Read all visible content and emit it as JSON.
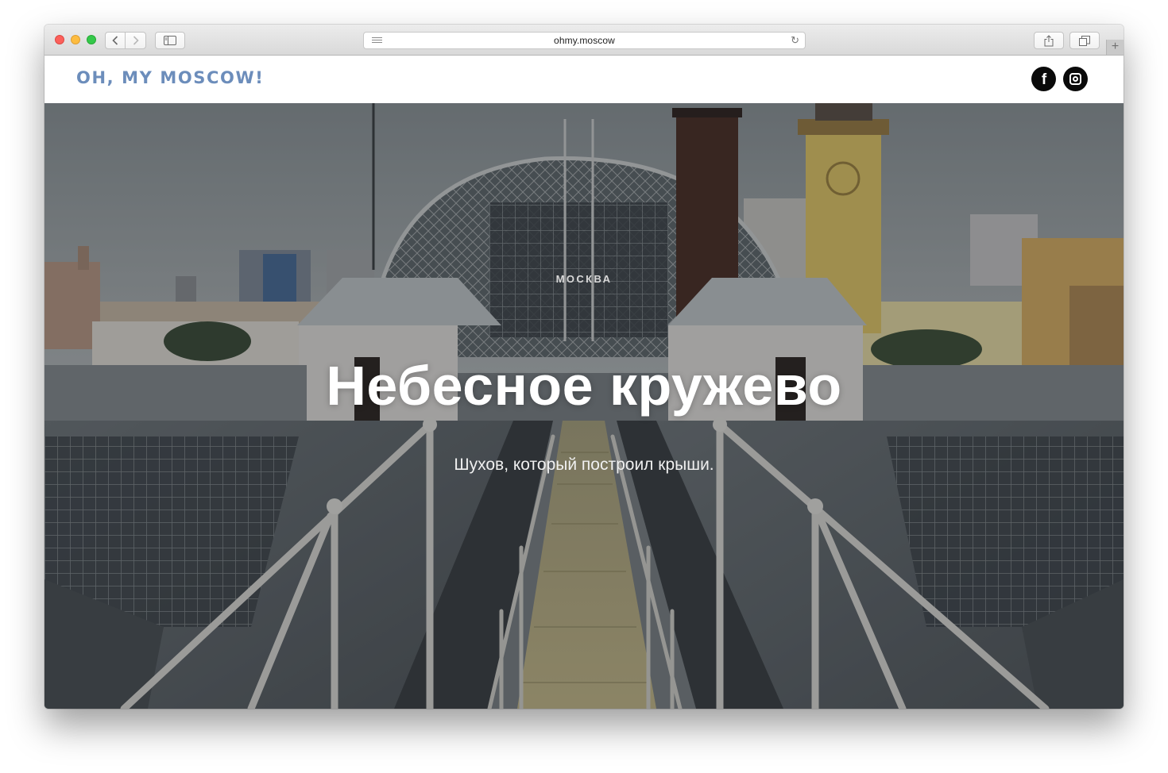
{
  "browser": {
    "url": "ohmy.moscow",
    "back_icon": "chevron-left",
    "forward_icon": "chevron-right",
    "new_tab_icon": "plus"
  },
  "site": {
    "brand": "OH, MY MOSCOW!",
    "brand_color": "#6c8dbb",
    "social": [
      {
        "name": "facebook",
        "glyph": "f"
      },
      {
        "name": "instagram",
        "glyph": "camera-outline"
      }
    ]
  },
  "hero": {
    "kicker": "МОСКВА",
    "title": "Небесное кружево",
    "subtitle": "Шухов, который построил крыши."
  }
}
